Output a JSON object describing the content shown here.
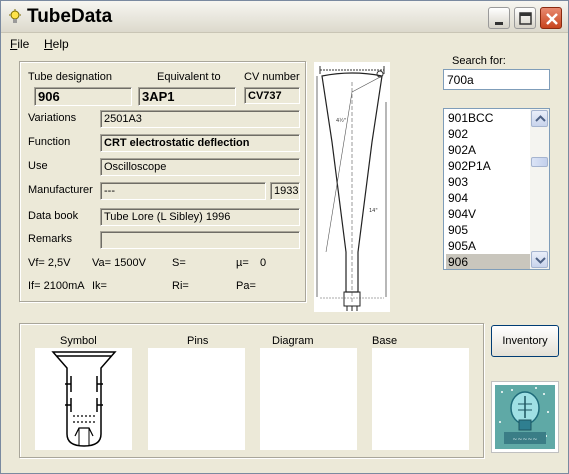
{
  "app": {
    "title": "TubeData"
  },
  "menu": {
    "file": "File",
    "file_key": "F",
    "file_rest": "ile",
    "help": "Help",
    "help_key": "H",
    "help_rest": "elp"
  },
  "header_labels": {
    "designation": "Tube designation",
    "equivalent": "Equivalent to",
    "cv": "CV number"
  },
  "tube": {
    "designation": "906",
    "equivalent": "3AP1",
    "cv": "CV737",
    "variations": "2501A3",
    "function": "CRT electrostatic deflection",
    "use": "Oscilloscope",
    "manufacturer": "---",
    "year": "1933",
    "data_book": "Tube Lore (L Sibley) 1996",
    "remarks": ""
  },
  "field_labels": {
    "variations": "Variations",
    "function": "Function",
    "use": "Use",
    "manufacturer": "Manufacturer",
    "data_book": "Data book",
    "remarks": "Remarks"
  },
  "params": {
    "vf": "Vf= 2,5V",
    "va": "Va= 1500V",
    "s": "S=",
    "mu": "µ=",
    "mu_value": "0",
    "if": "If= 2100mA",
    "ik": "Ik=",
    "ri": "Ri=",
    "pa": "Pa="
  },
  "search": {
    "label": "Search for:",
    "value": "700a"
  },
  "list": {
    "items": [
      "901BCC",
      "902",
      "902A",
      "902P1A",
      "903",
      "904",
      "904V",
      "905",
      "905A",
      "906"
    ],
    "selected": "906"
  },
  "panels": {
    "symbol": "Symbol",
    "pins": "Pins",
    "diagram": "Diagram",
    "base": "Base"
  },
  "buttons": {
    "inventory": "Inventory"
  },
  "colors": {
    "selection": "#c9c6bd",
    "window_bg": "#ece9d8",
    "close": "#c8441e"
  }
}
